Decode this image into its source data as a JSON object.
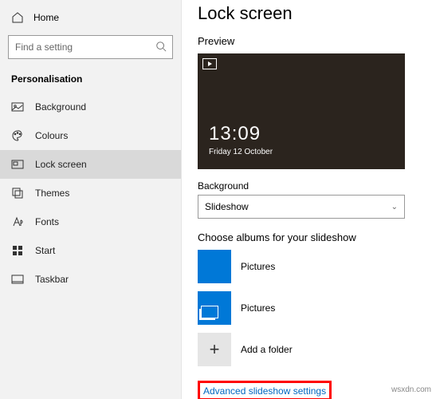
{
  "sidebar": {
    "home_label": "Home",
    "search_placeholder": "Find a setting",
    "section": "Personalisation",
    "items": [
      {
        "label": "Background"
      },
      {
        "label": "Colours"
      },
      {
        "label": "Lock screen"
      },
      {
        "label": "Themes"
      },
      {
        "label": "Fonts"
      },
      {
        "label": "Start"
      },
      {
        "label": "Taskbar"
      }
    ]
  },
  "main": {
    "title": "Lock screen",
    "preview_heading": "Preview",
    "clock": "13:09",
    "date": "Friday 12 October",
    "background_label": "Background",
    "background_value": "Slideshow",
    "albums_heading": "Choose albums for your slideshow",
    "albums": [
      {
        "label": "Pictures"
      },
      {
        "label": "Pictures"
      }
    ],
    "add_folder_label": "Add a folder",
    "advanced_link": "Advanced slideshow settings"
  },
  "watermark": "wsxdn.com"
}
